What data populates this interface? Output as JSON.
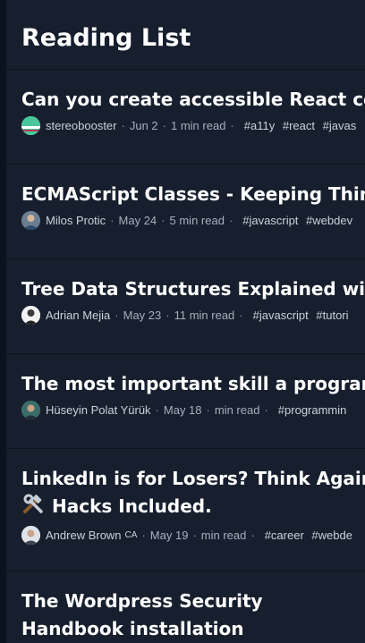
{
  "header": {
    "title": "Reading List"
  },
  "colors": {
    "background": "#0b1320",
    "card": "#171f2e",
    "title_text": "#ffffff",
    "meta_text": "#a6afbd"
  },
  "items": [
    {
      "title": "Can you create accessible React com",
      "author": "stereobooster",
      "date": "Jun 2",
      "read_time": "1 min read",
      "tags": [
        "#a11y",
        "#react",
        "#javas"
      ],
      "avatar_icon": "green-stripes-avatar"
    },
    {
      "title": "ECMAScript Classes - Keeping Thing",
      "author": "Milos Protic",
      "date": "May 24",
      "read_time": "5 min read",
      "tags": [
        "#javascript",
        "#webdev"
      ],
      "avatar_icon": "person-avatar"
    },
    {
      "title": "Tree Data Structures Explained with",
      "author": "Adrian Mejia",
      "date": "May 23",
      "read_time": "11 min read",
      "tags": [
        "#javascript",
        "#tutori"
      ],
      "avatar_icon": "person-avatar"
    },
    {
      "title": "The most important skill a program",
      "author": "Hüseyin Polat Yürük",
      "date": "May 18",
      "read_time": "min read",
      "tags": [
        "#programmin"
      ],
      "avatar_icon": "person-avatar"
    },
    {
      "title_line1": "LinkedIn is for Losers? Think Again.",
      "title_line2": "Hacks Included.",
      "title_emoji": "hammer-and-wrench-icon",
      "author": "Andrew Brown",
      "author_badge": "CA",
      "date": "May 19",
      "read_time": "min read",
      "tags": [
        "#career",
        "#webde"
      ],
      "avatar_icon": "person-avatar"
    },
    {
      "title": "The Wordpress Security Handbook installation"
    }
  ]
}
